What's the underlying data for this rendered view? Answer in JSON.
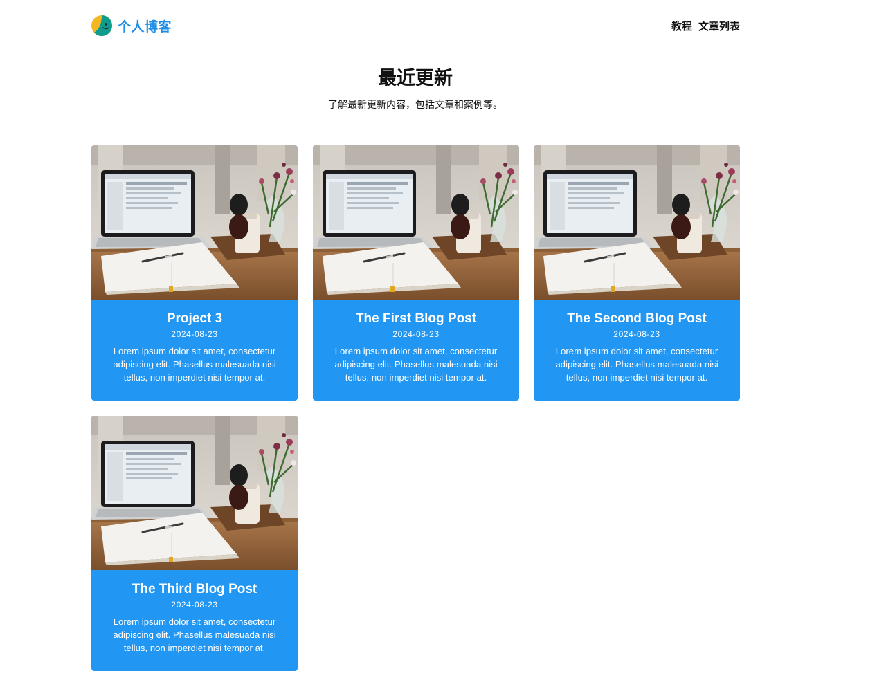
{
  "header": {
    "brand": "个人博客",
    "nav": [
      "教程",
      "文章列表"
    ]
  },
  "hero": {
    "title": "最近更新",
    "subtitle": "了解最新更新内容，包括文章和案例等。"
  },
  "cards": [
    {
      "title": "Project 3",
      "date": "2024-08-23",
      "excerpt": "Lorem ipsum dolor sit amet, consectetur adipiscing elit. Phasellus malesuada nisi tellus, non imperdiet nisi tempor at."
    },
    {
      "title": "The First Blog Post",
      "date": "2024-08-23",
      "excerpt": "Lorem ipsum dolor sit amet, consectetur adipiscing elit. Phasellus malesuada nisi tellus, non imperdiet nisi tempor at."
    },
    {
      "title": "The Second Blog Post",
      "date": "2024-08-23",
      "excerpt": "Lorem ipsum dolor sit amet, consectetur adipiscing elit. Phasellus malesuada nisi tellus, non imperdiet nisi tempor at."
    },
    {
      "title": "The Third Blog Post",
      "date": "2024-08-23",
      "excerpt": "Lorem ipsum dolor sit amet, consectetur adipiscing elit. Phasellus malesuada nisi tellus, non imperdiet nisi tempor at."
    }
  ],
  "colors": {
    "accent": "#1e8fe8",
    "card_background": "#2196f3",
    "text": "#111111"
  },
  "icons": {
    "logo": "smiling-face-logo",
    "card_image": "laptop-notebook-desk-photo"
  }
}
